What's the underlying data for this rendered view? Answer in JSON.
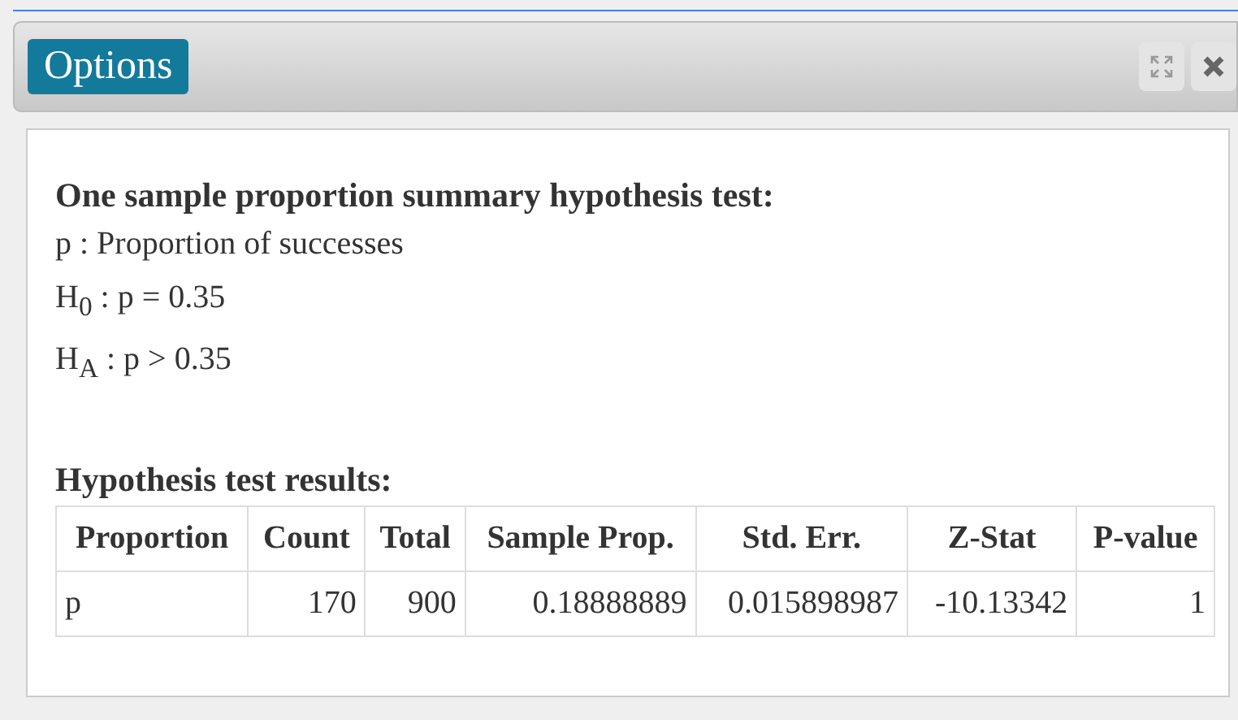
{
  "header": {
    "title": "Options"
  },
  "summary": {
    "heading": "One sample proportion summary hypothesis test:",
    "lines": [
      "p : Proportion of successes",
      "H$_{0}$ : p = 0.35",
      "H$_{A}$ : p > 0.35"
    ]
  },
  "results": {
    "heading": "Hypothesis test results:",
    "columns": [
      "Proportion",
      "Count",
      "Total",
      "Sample Prop.",
      "Std. Err.",
      "Z-Stat",
      "P-value"
    ],
    "rows": [
      [
        "p",
        "170",
        "900",
        "0.18888889",
        "0.015898987",
        "-10.13342",
        "1"
      ]
    ]
  }
}
